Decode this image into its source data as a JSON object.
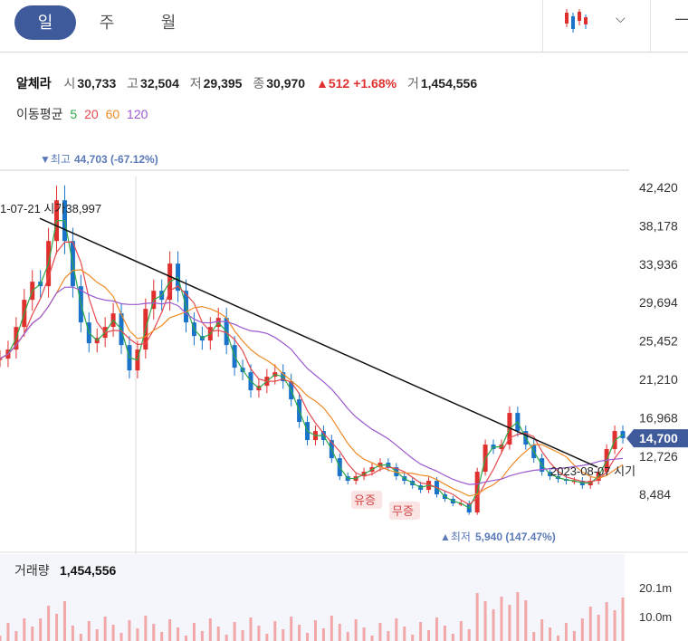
{
  "tabs": [
    {
      "label": "일",
      "active": true
    },
    {
      "label": "주",
      "active": false
    },
    {
      "label": "월",
      "active": false
    }
  ],
  "toolbar": {
    "chart_type_icon": "candlestick-icon",
    "dropdown_icon": "chevron-down-icon",
    "minimize_icon": "minus-icon"
  },
  "quote": {
    "name": "알체라",
    "open_label": "시",
    "open": "30,733",
    "high_label": "고",
    "high": "32,504",
    "low_label": "저",
    "low": "29,395",
    "close_label": "종",
    "close": "30,970",
    "change": "▲512",
    "change_pct": "+1.68%",
    "volume_label": "거",
    "volume": "1,454,556"
  },
  "ma_legend": {
    "label": "이동평균",
    "items": [
      {
        "period": "5",
        "color": "#2ea84a"
      },
      {
        "period": "20",
        "color": "#e5484d"
      },
      {
        "period": "60",
        "color": "#f08a24"
      },
      {
        "period": "120",
        "color": "#9b59d0"
      }
    ]
  },
  "colors": {
    "up": "#e0302e",
    "down": "#1a73c8",
    "accent": "#3e5a9a",
    "price_tag": "#3e5a9a",
    "annotation": "#5b7ab8"
  },
  "chart_data": {
    "type": "candlestick",
    "price_axis": {
      "ticks": [
        42420,
        38178,
        33936,
        29694,
        25452,
        21210,
        16968,
        12726,
        8484
      ],
      "labels": [
        "42,420",
        "38,178",
        "33,936",
        "29,694",
        "25,452",
        "21,210",
        "16,968",
        "12,726",
        "8,484"
      ]
    },
    "current_price": {
      "value": 14700,
      "label": "14,700"
    },
    "high_marker": {
      "label": "▼최고",
      "value": "44,703",
      "pct": "(-67.12%)",
      "price": 44703
    },
    "low_marker": {
      "label": "▲최저",
      "value": "5,940",
      "pct": "(147.47%)",
      "price": 5940
    },
    "trendline_start_label": "1-07-21 시가38,997",
    "trendline_start_price": 38997,
    "trendline_end_label": "2023-08-07 시기",
    "trendline_end_price": 11500,
    "events": [
      {
        "label": "유증"
      },
      {
        "label": "무증"
      }
    ],
    "close_path": [
      23500,
      24500,
      27000,
      30000,
      32000,
      31500,
      36500,
      41000,
      36500,
      31500,
      27500,
      25200,
      25800,
      27000,
      28500,
      25000,
      22200,
      24500,
      29000,
      31000,
      30000,
      34000,
      31000,
      27500,
      26000,
      25500,
      27000,
      28000,
      25000,
      22500,
      22000,
      20000,
      20500,
      21500,
      22000,
      21000,
      19000,
      16500,
      14500,
      15500,
      14500,
      12500,
      10500,
      10000,
      10500,
      11000,
      11500,
      12000,
      11500,
      10500,
      10000,
      9500,
      9000,
      10000,
      8500,
      8000,
      7500,
      7500,
      6500,
      11000,
      14000,
      13500,
      14000,
      17500,
      15500,
      14000,
      12500,
      11000,
      10500,
      10200,
      10000,
      10000,
      9500,
      10000,
      11000,
      13500,
      15500,
      14700
    ],
    "volume_panel": {
      "title": "거래량",
      "value": "1,454,556",
      "ticks": [
        "20.1m",
        "10.0m"
      ]
    }
  }
}
